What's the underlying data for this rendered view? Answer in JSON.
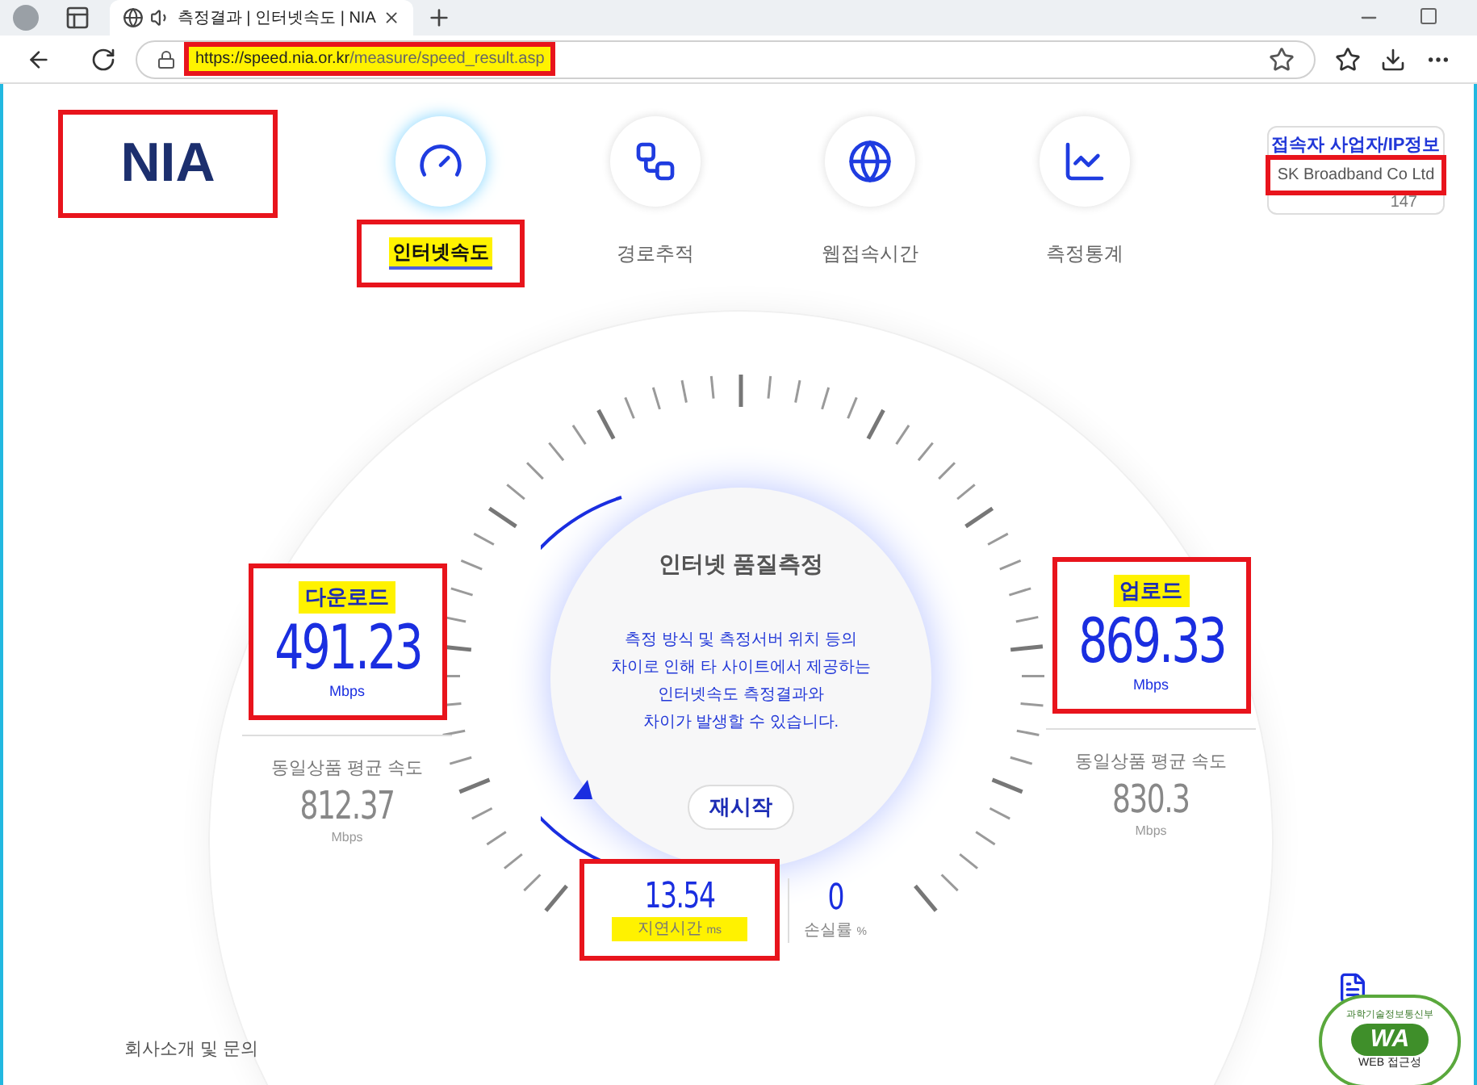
{
  "browser": {
    "tab_title": "측정결과 | 인터넷속도 | NIA",
    "url_host": "https://speed.nia.or.kr",
    "url_path": "/measure/speed_result.asp",
    "url_highlighted": true,
    "url_annotated": true
  },
  "logo": {
    "text": "NIA",
    "annotated": true
  },
  "nav": [
    {
      "label": "인터넷속도",
      "kind": "speed",
      "selected": true,
      "highlighted": true,
      "annotated": true
    },
    {
      "label": "경로추적",
      "kind": "route",
      "selected": false,
      "highlighted": false,
      "annotated": false
    },
    {
      "label": "웹접속시간",
      "kind": "web",
      "selected": false,
      "highlighted": false,
      "annotated": false
    },
    {
      "label": "측정통계",
      "kind": "stats",
      "selected": false,
      "highlighted": false,
      "annotated": false
    }
  ],
  "isp": {
    "title": "접속자 사업자/IP정보",
    "name": "SK Broadband Co Ltd",
    "ip": "147",
    "name_annotated": true
  },
  "gauge": {
    "title": "인터넷 품질측정",
    "notice": [
      "측정 방식 및 측정서버 위치 등의",
      "차이로 인해 타 사이트에서 제공하는",
      "인터넷속도 측정결과와",
      "차이가 발생할 수 있습니다."
    ],
    "button": "재시작"
  },
  "download": {
    "label": "다운로드",
    "value": "491.23",
    "unit": "Mbps",
    "avg_label": "동일상품 평균 속도",
    "avg_value": "812.37",
    "avg_unit": "Mbps",
    "highlighted": true,
    "annotated": true
  },
  "upload": {
    "label": "업로드",
    "value": "869.33",
    "unit": "Mbps",
    "avg_label": "동일상품 평균 속도",
    "avg_value": "830.3",
    "avg_unit": "Mbps",
    "highlighted": true,
    "annotated": true
  },
  "latency": {
    "value": "13.54",
    "label": "지연시간",
    "unit": "ms",
    "highlighted": true,
    "annotated": true
  },
  "loss": {
    "value": "0",
    "label": "손실률",
    "unit": "%"
  },
  "footer": {
    "link": "회사소개 및 문의",
    "badge": {
      "top": "과학기술정보통신부",
      "mark": "WA",
      "bottom": "WEB 접근성"
    }
  }
}
